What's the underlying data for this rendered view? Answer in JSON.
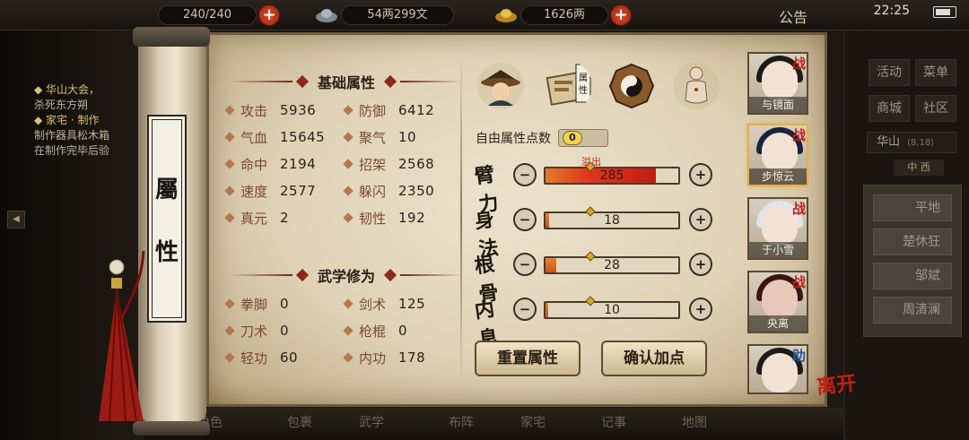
{
  "topbar": {
    "stamina": "240/240",
    "silver": "54两299文",
    "gold": "1626两",
    "announcement": "公告",
    "time": "22:25"
  },
  "background_left": {
    "lines": [
      {
        "text": "◆ 华山大会，",
        "highlight": true
      },
      {
        "text": "杀死东方朔",
        "highlight": false
      },
      {
        "text": "◆ 家宅 · 制作",
        "highlight": true
      },
      {
        "text": "制作器具松木箱",
        "highlight": false
      },
      {
        "text": "在制作完毕后验",
        "highlight": false
      }
    ]
  },
  "background_right": {
    "buttons": [
      "活动",
      "菜单",
      "商城",
      "社区"
    ],
    "location": "华山",
    "location_coords": "(8,18)",
    "tab": "中 西",
    "npcs": [
      "平地",
      "楚休狂",
      "邹斌",
      "周清澜"
    ]
  },
  "bottombar": {
    "items": [
      "角色",
      "包裹",
      "武学",
      "布阵",
      "家宅",
      "记事",
      "地图"
    ]
  },
  "panel": {
    "title_chars": [
      "屬",
      "性"
    ],
    "basic": {
      "heading": "基础属性",
      "stats": [
        {
          "label": "攻击",
          "value": "5936"
        },
        {
          "label": "防御",
          "value": "6412"
        },
        {
          "label": "气血",
          "value": "15645"
        },
        {
          "label": "聚气",
          "value": "10"
        },
        {
          "label": "命中",
          "value": "2194"
        },
        {
          "label": "招架",
          "value": "2568"
        },
        {
          "label": "速度",
          "value": "2577"
        },
        {
          "label": "躲闪",
          "value": "2350"
        },
        {
          "label": "真元",
          "value": "2"
        },
        {
          "label": "韧性",
          "value": "192"
        }
      ]
    },
    "martial": {
      "heading": "武学修为",
      "stats": [
        {
          "label": "拳脚",
          "value": "0"
        },
        {
          "label": "剑术",
          "value": "125"
        },
        {
          "label": "刀术",
          "value": "0"
        },
        {
          "label": "枪棍",
          "value": "0"
        },
        {
          "label": "轻功",
          "value": "60"
        },
        {
          "label": "内功",
          "value": "178"
        }
      ]
    },
    "tabs": [
      {
        "name": "character-tab",
        "label": ""
      },
      {
        "name": "attributes-tab",
        "label": "属性"
      },
      {
        "name": "bagua-tab",
        "label": ""
      },
      {
        "name": "meridian-tab",
        "label": ""
      }
    ],
    "free_points_label": "自由属性点数",
    "free_points": "0",
    "overflow_label": "溢出",
    "attributes": [
      {
        "name": "臂力",
        "value": "285",
        "fill": 0.83,
        "overflow": true
      },
      {
        "name": "身法",
        "value": "18",
        "fill": 0.03,
        "overflow": false
      },
      {
        "name": "根骨",
        "value": "28",
        "fill": 0.08,
        "overflow": false
      },
      {
        "name": "内息",
        "value": "10",
        "fill": 0.02,
        "overflow": false
      }
    ],
    "reset_label": "重置属性",
    "confirm_label": "确认加点"
  },
  "characters": [
    {
      "name": "与镜面",
      "badge": "战",
      "selected": false
    },
    {
      "name": "步惊云",
      "badge": "战",
      "selected": true
    },
    {
      "name": "于小雪",
      "badge": "战",
      "selected": false
    },
    {
      "name": "央离",
      "badge": "战",
      "selected": false
    },
    {
      "name": "",
      "badge": "助",
      "selected": false
    }
  ],
  "leave_label": "离开",
  "colors": {
    "parchment": "#dfd2b6",
    "accent_red": "#c81e12",
    "bar_orange": "#e07a2a"
  }
}
